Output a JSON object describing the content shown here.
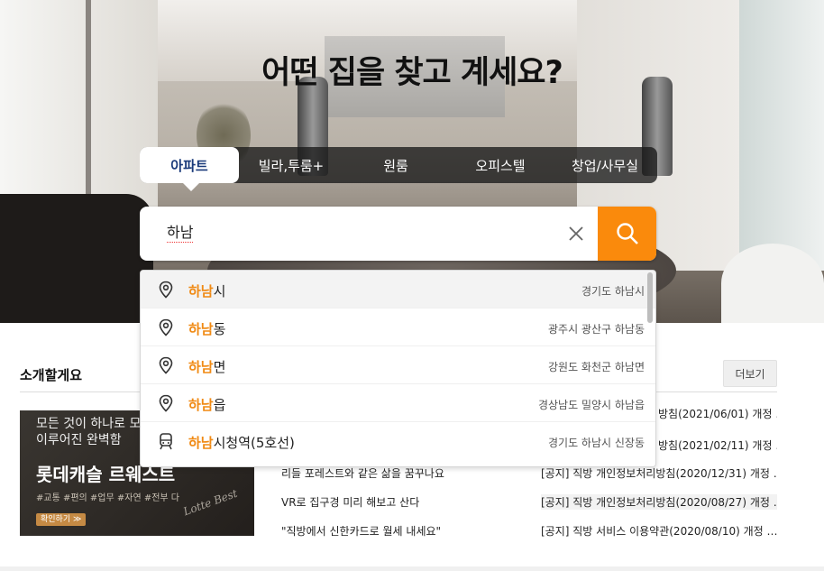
{
  "hero": {
    "headline": "어떤 집을 찾고 계세요?"
  },
  "tabs": [
    {
      "label": "아파트",
      "active": true
    },
    {
      "label": "빌라,투룸+",
      "active": false
    },
    {
      "label": "원룸",
      "active": false
    },
    {
      "label": "오피스텔",
      "active": false
    },
    {
      "label": "창업/사무실",
      "active": false
    }
  ],
  "search": {
    "value": "하남",
    "clear_icon": "close-icon",
    "button_icon": "search-icon",
    "accent_color": "#fa8a0c"
  },
  "suggestions": [
    {
      "match": "하남",
      "rest": "시",
      "address": "경기도 하남시",
      "icon": "location-pin-icon",
      "highlighted": true
    },
    {
      "match": "하남",
      "rest": "동",
      "address": "광주시 광산구 하남동",
      "icon": "location-pin-icon",
      "highlighted": false
    },
    {
      "match": "하남",
      "rest": "면",
      "address": "강원도 화천군 하남면",
      "icon": "location-pin-icon",
      "highlighted": false
    },
    {
      "match": "하남",
      "rest": "읍",
      "address": "경상남도 밀양시 하남읍",
      "icon": "location-pin-icon",
      "highlighted": false
    },
    {
      "match": "하남",
      "rest": "시청역(5호선)",
      "address": "경기도 하남시 신장동",
      "icon": "subway-icon",
      "highlighted": false
    }
  ],
  "intro": {
    "title": "소개할게요",
    "banner": {
      "line1": "모든 것이 하나로 모",
      "line2": "이루어진 완벽함",
      "line3": "롯데캐슬 르웨스트",
      "tags": "#교통 #편의 #업무 #자연 #전부 다",
      "button": "확인하기 ≫",
      "signature": "Lotte Best"
    },
    "news": [
      "리들 포레스트와 같은 삶을 꿈꾸나요",
      "VR로 집구경 미리 해보고 산다",
      "\"직방에서 신한카드로 월세 내세요\""
    ]
  },
  "notices": {
    "more_label": "더보기",
    "items": [
      "방침(2021/06/01) 개정 …",
      "방침(2021/02/11) 개정 …",
      "[공지] 직방 개인정보처리방침(2020/12/31) 개정 …",
      "[공지] 직방 개인정보처리방침(2020/08/27) 개정 …",
      "[공지] 직방 서비스 이용약관(2020/08/10) 개정 …"
    ]
  }
}
